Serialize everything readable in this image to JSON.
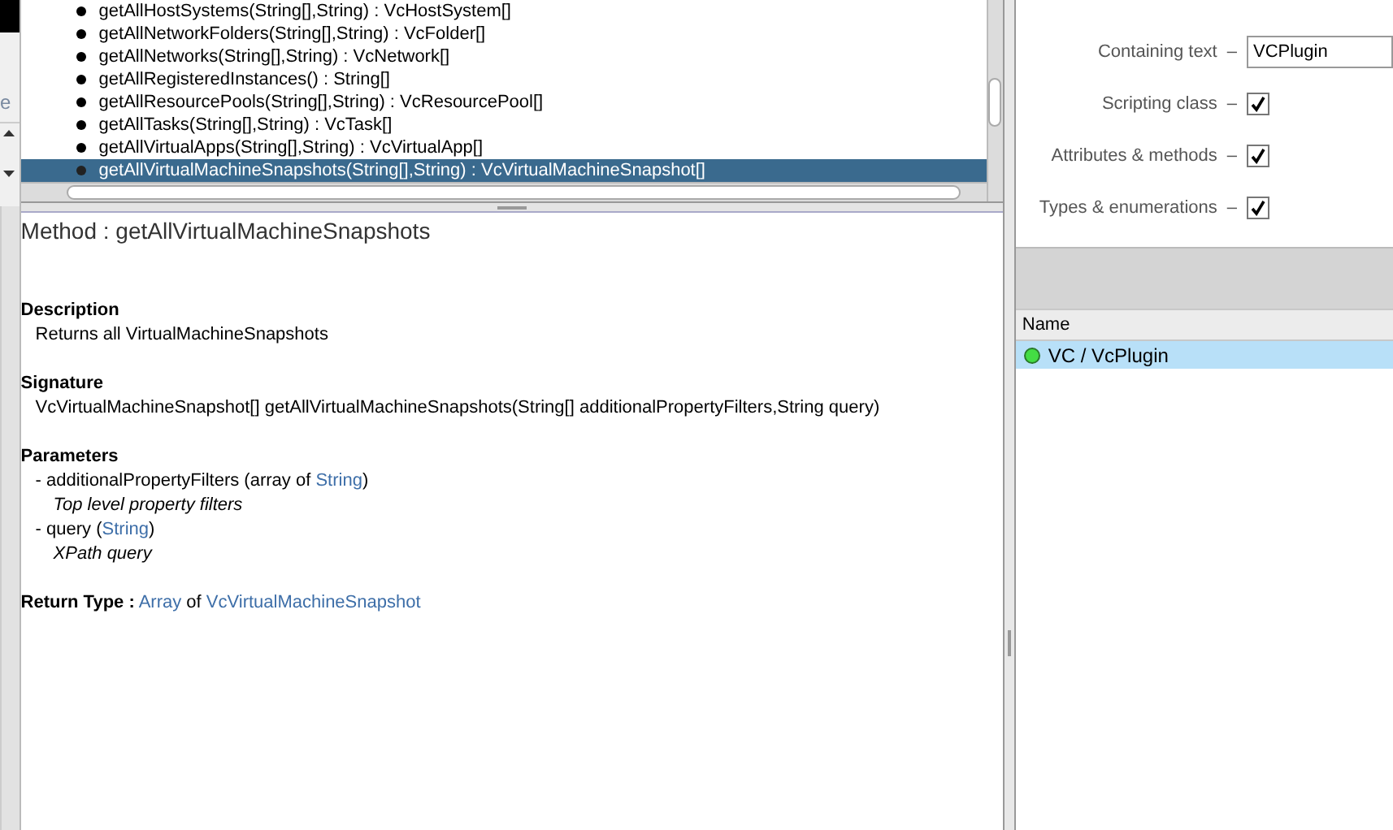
{
  "left_panel": {
    "text": "e"
  },
  "methods": {
    "items": [
      {
        "label": "getAllHostSystems(String[],String) : VcHostSystem[]",
        "selected": false
      },
      {
        "label": "getAllNetworkFolders(String[],String) : VcFolder[]",
        "selected": false
      },
      {
        "label": "getAllNetworks(String[],String) : VcNetwork[]",
        "selected": false
      },
      {
        "label": "getAllRegisteredInstances() : String[]",
        "selected": false
      },
      {
        "label": "getAllResourcePools(String[],String) : VcResourcePool[]",
        "selected": false
      },
      {
        "label": "getAllTasks(String[],String) : VcTask[]",
        "selected": false
      },
      {
        "label": "getAllVirtualApps(String[],String) : VcVirtualApp[]",
        "selected": false
      },
      {
        "label": "getAllVirtualMachineSnapshots(String[],String) : VcVirtualMachineSnapshot[]",
        "selected": true
      }
    ]
  },
  "details": {
    "title": "Method : getAllVirtualMachineSnapshots",
    "description": {
      "heading": "Description",
      "text": "Returns all VirtualMachineSnapshots"
    },
    "signature": {
      "heading": "Signature",
      "text": "VcVirtualMachineSnapshot[] getAllVirtualMachineSnapshots(String[] additionalPropertyFilters,String query)"
    },
    "parameters": {
      "heading": "Parameters",
      "items": [
        {
          "before": "- additionalPropertyFilters (array of ",
          "link": "String",
          "after": ")",
          "note": "Top level property filters"
        },
        {
          "before": "- query (",
          "link": "String",
          "after": ")",
          "note": "XPath query"
        }
      ]
    },
    "return_type": {
      "label": "Return Type :",
      "link": "Array",
      "middle": " of ",
      "type_link": "VcVirtualMachineSnapshot"
    }
  },
  "search": {
    "fields": [
      {
        "kind": "text",
        "label": "Containing text",
        "dash": "–",
        "value": "VCPlugin"
      },
      {
        "kind": "checkbox",
        "label": "Scripting class",
        "dash": "–",
        "checked": true
      },
      {
        "kind": "checkbox",
        "label": "Attributes & methods",
        "dash": "–",
        "checked": true
      },
      {
        "kind": "checkbox",
        "label": "Types & enumerations",
        "dash": "–",
        "checked": true
      }
    ]
  },
  "results": {
    "columns": [
      "Name"
    ],
    "rows": [
      {
        "label": "VC / VcPlugin",
        "selected": true,
        "color": "#44dd44"
      }
    ]
  }
}
